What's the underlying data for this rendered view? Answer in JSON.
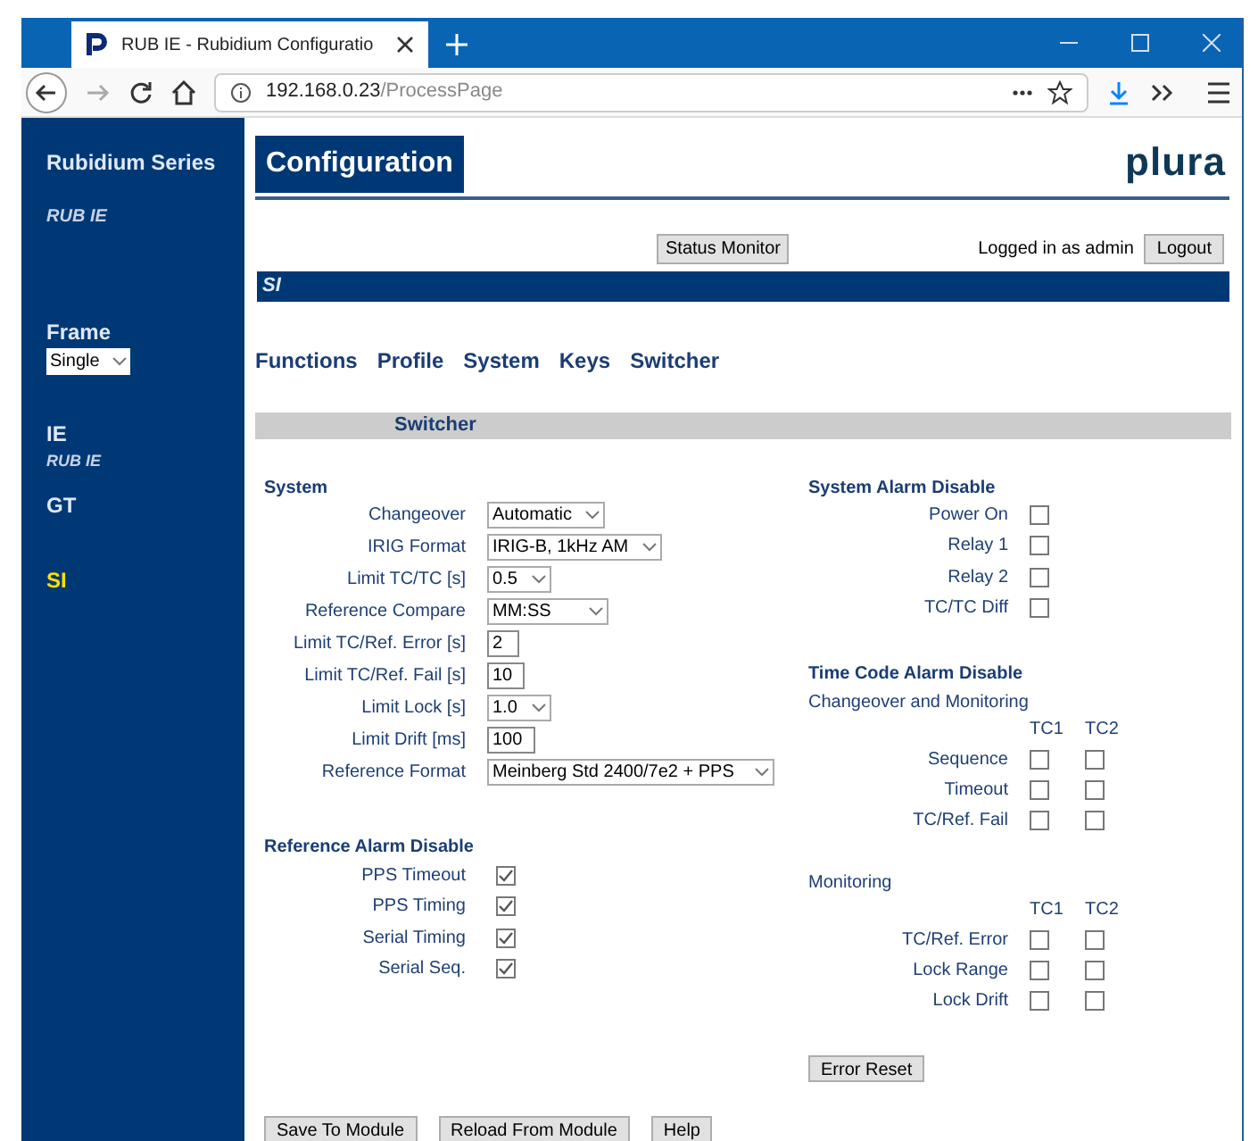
{
  "browser": {
    "tab_title": "RUB IE - Rubidium Configuratio",
    "url_host": "192.168.0.23",
    "url_path": "/ProcessPage"
  },
  "sidebar": {
    "title": "Rubidium Series",
    "subtitle": "RUB IE",
    "frame_label": "Frame",
    "frame_value": "Single",
    "items": [
      {
        "label": "IE",
        "sub": "RUB IE",
        "selected": false
      },
      {
        "label": "GT",
        "selected": false
      },
      {
        "label": "SI",
        "selected": true
      }
    ]
  },
  "header": {
    "title": "Configuration",
    "logo": "plura",
    "status_button": "Status Monitor",
    "login_text": "Logged in as admin",
    "logout_button": "Logout",
    "module_bar": "SI"
  },
  "menu": [
    {
      "label": "Functions"
    },
    {
      "label": "Profile"
    },
    {
      "label": "System"
    },
    {
      "label": "Keys"
    },
    {
      "label": "Switcher"
    }
  ],
  "section_title": "Switcher",
  "system": {
    "heading": "System",
    "fields": [
      {
        "label": "Changeover",
        "kind": "select",
        "value": "Automatic"
      },
      {
        "label": "IRIG Format",
        "kind": "select",
        "value": "IRIG-B, 1kHz AM"
      },
      {
        "label": "Limit TC/TC [s]",
        "kind": "select",
        "value": "0.5"
      },
      {
        "label": "Reference Compare",
        "kind": "select",
        "value": "MM:SS"
      },
      {
        "label": "Limit TC/Ref. Error [s]",
        "kind": "input",
        "value": "2"
      },
      {
        "label": "Limit TC/Ref. Fail [s]",
        "kind": "input",
        "value": "10"
      },
      {
        "label": "Limit Lock [s]",
        "kind": "select",
        "value": "1.0"
      },
      {
        "label": "Limit Drift [ms]",
        "kind": "input",
        "value": "100"
      },
      {
        "label": "Reference Format",
        "kind": "select",
        "value": "Meinberg Std 2400/7e2 + PPS"
      }
    ]
  },
  "reference_alarm": {
    "heading": "Reference Alarm Disable",
    "items": [
      {
        "label": "PPS Timeout",
        "checked": true
      },
      {
        "label": "PPS Timing",
        "checked": true
      },
      {
        "label": "Serial Timing",
        "checked": true
      },
      {
        "label": "Serial Seq.",
        "checked": true
      }
    ]
  },
  "system_alarm": {
    "heading": "System Alarm Disable",
    "items": [
      {
        "label": "Power On",
        "checked": false
      },
      {
        "label": "Relay 1",
        "checked": false
      },
      {
        "label": "Relay 2",
        "checked": false
      },
      {
        "label": "TC/TC Diff",
        "checked": false
      }
    ]
  },
  "timecode_alarm": {
    "heading": "Time Code Alarm Disable",
    "groups": [
      {
        "title": "Changeover and Monitoring",
        "columns": [
          "TC1",
          "TC2"
        ],
        "rows": [
          {
            "label": "Sequence",
            "checks": [
              false,
              false
            ]
          },
          {
            "label": "Timeout",
            "checks": [
              false,
              false
            ]
          },
          {
            "label": "TC/Ref. Fail",
            "checks": [
              false,
              false
            ]
          }
        ]
      },
      {
        "title": "Monitoring",
        "columns": [
          "TC1",
          "TC2"
        ],
        "rows": [
          {
            "label": "TC/Ref. Error",
            "checks": [
              false,
              false
            ]
          },
          {
            "label": "Lock Range",
            "checks": [
              false,
              false
            ]
          },
          {
            "label": "Lock Drift",
            "checks": [
              false,
              false
            ]
          }
        ]
      }
    ]
  },
  "error_reset_button": "Error Reset",
  "footer_buttons": [
    "Save To Module",
    "Reload From Module",
    "Help"
  ]
}
